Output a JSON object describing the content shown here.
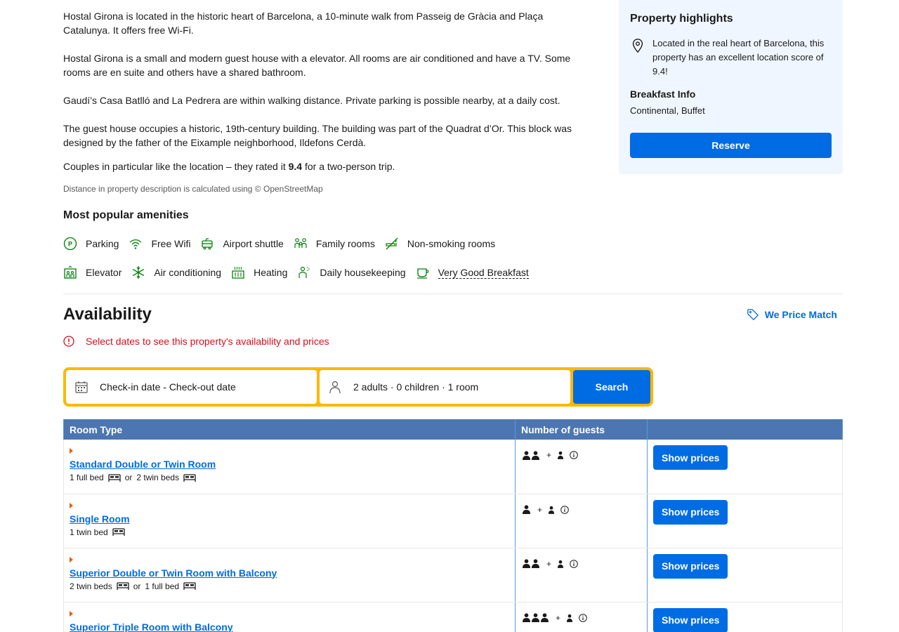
{
  "description": {
    "p1": "Hostal Girona is located in the historic heart of Barcelona, a 10-minute walk from Passeig de Gràcia and Plaça Catalunya. It offers free Wi-Fi.",
    "p2": "Hostal Girona is a small and modern guest house with a elevator. All rooms are air conditioned and have a TV. Some rooms are en suite and others have a shared bathroom.",
    "p3": "Gaudí’s Casa Batlló and La Pedrera are within walking distance. Private parking is possible nearby, at a daily cost.",
    "p4": "The guest house occupies a historic, 19th-century building. The building was part of the Quadrat d’Or. This block was designed by the father of the Eixample neighborhood, Ildefons Cerdà.",
    "couples_prefix": "Couples in particular like the location – they rated it ",
    "couples_score": "9.4",
    "couples_suffix": " for a two-person trip.",
    "distance_note": "Distance in property description is calculated using © OpenStreetMap"
  },
  "highlights": {
    "title": "Property highlights",
    "location_text": "Located in the real heart of Barcelona, this property has an excellent location score of 9.4!",
    "breakfast_title": "Breakfast Info",
    "breakfast_value": "Continental, Buffet",
    "reserve_label": "Reserve"
  },
  "amenities": {
    "title": "Most popular amenities",
    "row1": [
      "Parking",
      "Free Wifi",
      "Airport shuttle",
      "Family rooms",
      "Non-smoking rooms"
    ],
    "row2": [
      "Elevator",
      "Air conditioning",
      "Heating",
      "Daily housekeeping",
      "Very Good Breakfast"
    ]
  },
  "availability": {
    "title": "Availability",
    "price_match": "We Price Match",
    "alert": "Select dates to see this property's availability and prices"
  },
  "search": {
    "dates": "Check-in date - Check-out date",
    "guests": "2 adults · 0 children · 1 room",
    "button": "Search"
  },
  "table": {
    "headers": [
      "Room Type",
      "Number of guests",
      ""
    ],
    "show_prices": "Show prices",
    "rooms": [
      {
        "name": "Standard Double or Twin Room",
        "bed1": "1 full bed",
        "or": "or",
        "bed2": "2 twin beds",
        "adults": 2,
        "children": 1
      },
      {
        "name": "Single Room",
        "bed1": "1 twin bed",
        "or": "",
        "bed2": "",
        "adults": 1,
        "children": 1
      },
      {
        "name": "Superior Double or Twin Room with Balcony",
        "bed1": "2 twin beds",
        "or": "or",
        "bed2": "1 full bed",
        "adults": 2,
        "children": 1
      },
      {
        "name": "Superior Triple Room with Balcony",
        "bed1": "",
        "or": "",
        "bed2": "",
        "adults": 3,
        "children": 1
      }
    ]
  },
  "colors": {
    "brand_blue": "#006ce4",
    "header_blue": "#4c76b2",
    "search_yellow": "#ffb700",
    "alert_red": "#d4111e",
    "amenity_green": "#008009"
  }
}
